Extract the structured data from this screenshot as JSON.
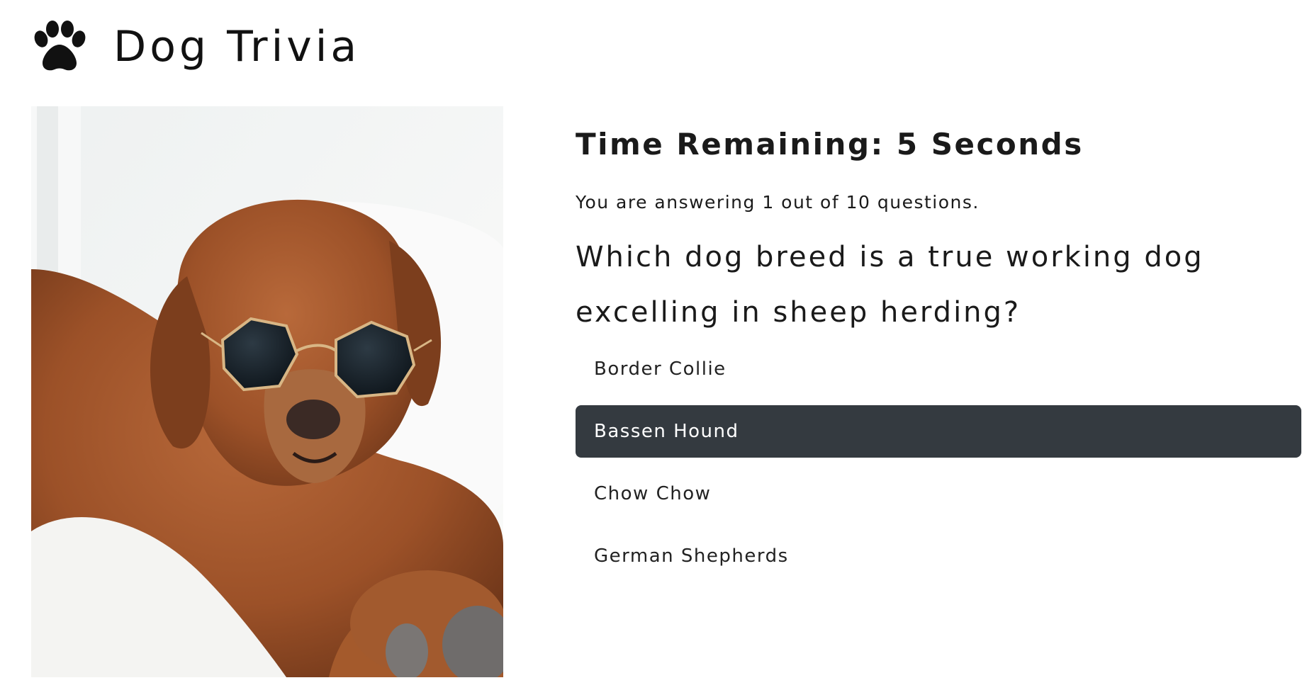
{
  "header": {
    "title": "Dog Trivia",
    "icon": "paw-icon"
  },
  "quiz": {
    "timer_text": "Time Remaining: 5 Seconds",
    "progress_text": "You are answering 1 out of 10 questions.",
    "question": "Which dog breed is a true working dog excelling in sheep herding?",
    "answers": [
      {
        "label": "Border Collie",
        "selected": false
      },
      {
        "label": "Bassen Hound",
        "selected": true
      },
      {
        "label": "Chow Chow",
        "selected": false
      },
      {
        "label": "German Shepherds",
        "selected": false
      }
    ]
  },
  "colors": {
    "selected_answer_bg": "#343a40",
    "selected_answer_text": "#ffffff"
  }
}
